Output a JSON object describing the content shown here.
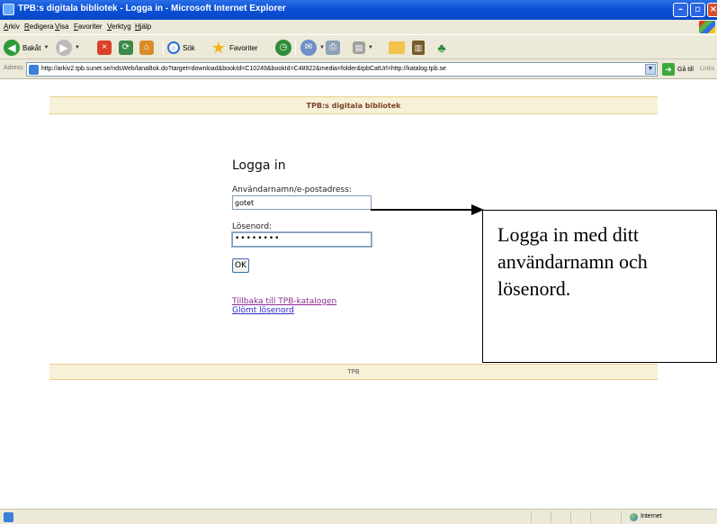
{
  "window": {
    "title": "TPB:s digitala bibliotek - Logga in - Microsoft Internet Explorer",
    "minimize": "–",
    "maximize": "▫",
    "close": "×"
  },
  "menubar": {
    "items": [
      "Arkiv",
      "Redigera",
      "Visa",
      "Favoriter",
      "Verktyg",
      "Hjälp"
    ]
  },
  "toolbar": {
    "back_label": "Bakåt",
    "search_label": "Sök",
    "favorites_label": "Favoriter"
  },
  "addressbar": {
    "label": "Adress",
    "url": "http://arkiv2.tpb.sunet.se/ndsWeb/lanaBok.do?target=download&bookId=C10249&bookId=C48922&media=folder&tpbCatUrl=http://katalog.tpb.se",
    "go_label": "Gå till",
    "links_label": "Links"
  },
  "page": {
    "header": "TPB:s digitala bibliotek",
    "login_title": "Logga in",
    "username_label": "Användarnamn/e-postadress:",
    "username_value": "gotet",
    "password_label": "Lösenord:",
    "password_value": "••••••••",
    "ok_label": "OK",
    "link_back": "Tillbaka till TPB-katalogen",
    "link_forgot": "Glömt lösenord",
    "footer": "TPB"
  },
  "callout": {
    "text": "Logga in med ditt\nanvändarnamn och\nlösenord."
  },
  "statusbar": {
    "zone": "Internet"
  }
}
